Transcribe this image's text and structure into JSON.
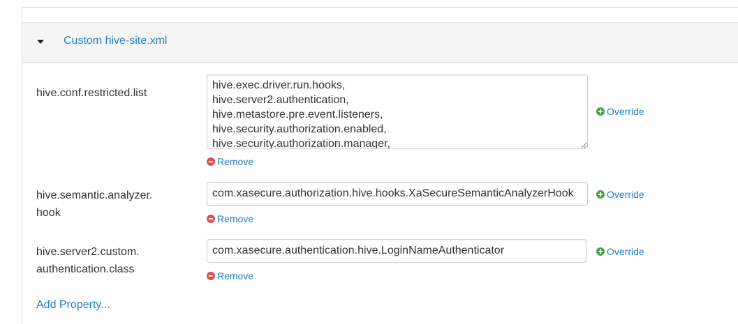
{
  "section": {
    "title": "Custom hive-site.xml"
  },
  "properties": [
    {
      "name": "hive.conf.restricted.list",
      "value": "hive.exec.driver.run.hooks,\nhive.server2.authentication,\nhive.metastore.pre.event.listeners,\nhive.security.authorization.enabled,\nhive.security.authorization.manager,",
      "override_label": "Override",
      "remove_label": "Remove"
    },
    {
      "name_line1": "hive.semantic.analyzer.",
      "name_line2": "hook",
      "value": "com.xasecure.authorization.hive.hooks.XaSecureSemanticAnalyzerHook",
      "override_label": "Override",
      "remove_label": "Remove"
    },
    {
      "name_line1": "hive.server2.custom.",
      "name_line2": "authentication.class",
      "value": "com.xasecure.authentication.hive.LoginNameAuthenticator",
      "override_label": "Override",
      "remove_label": "Remove"
    }
  ],
  "add_property_label": "Add Property...",
  "colors": {
    "link": "#1e7fc6",
    "override_icon": "#45a345",
    "remove_icon": "#d9534f",
    "header_bg": "#f5f5f5"
  },
  "icons": {
    "caret": "caret-down-icon",
    "override": "plus-circle-icon",
    "remove": "minus-circle-icon"
  }
}
